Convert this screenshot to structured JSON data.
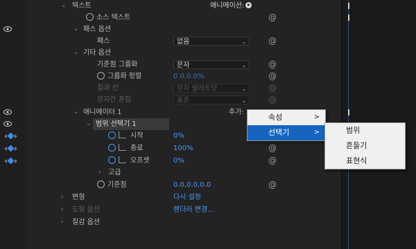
{
  "colors": {
    "accent": "#4a9af5",
    "keyframe": "#3b8cf0",
    "menu_highlight": "#1565c0"
  },
  "text_group": {
    "label": "텍스트",
    "animate_label": "애니메이션:"
  },
  "source_text": {
    "label": "소스 텍스트"
  },
  "path_options": {
    "label": "패스 옵션"
  },
  "path": {
    "label": "패스",
    "value": "없음"
  },
  "more_options": {
    "label": "기타 옵션"
  },
  "anchor_grouping": {
    "label": "기준점 그룹화",
    "value": "문자"
  },
  "grouping_alignment": {
    "label": "그룹화 정렬",
    "value": "0.0,0.0%"
  },
  "fill_stroke": {
    "label": "칠과 선",
    "value": "문자 팔레트당"
  },
  "inter_char_blend": {
    "label": "문자간 혼합",
    "value": "표준"
  },
  "animator": {
    "label": "애니메이터 1",
    "add_label": "추가:"
  },
  "range_selector": {
    "label": "범위 선택기 1"
  },
  "start": {
    "label": "시작",
    "value": "0%"
  },
  "end": {
    "label": "종료",
    "value": "100%"
  },
  "offset": {
    "label": "오프셋",
    "value": "0%"
  },
  "advanced": {
    "label": "고급"
  },
  "anchor_point": {
    "label": "기준점",
    "value": "0.0,0.0,0.0"
  },
  "transform": {
    "label": "변형",
    "value": "다시 설정"
  },
  "geometry_options": {
    "label": "도형 옵션",
    "value": "렌더러 변경..."
  },
  "material_options": {
    "label": "질감 옵션"
  },
  "context_menu": {
    "items": [
      {
        "label": "속성"
      },
      {
        "label": "선택기"
      }
    ]
  },
  "submenu": {
    "items": [
      {
        "label": "범위"
      },
      {
        "label": "흔들기"
      },
      {
        "label": "표현식"
      }
    ]
  }
}
